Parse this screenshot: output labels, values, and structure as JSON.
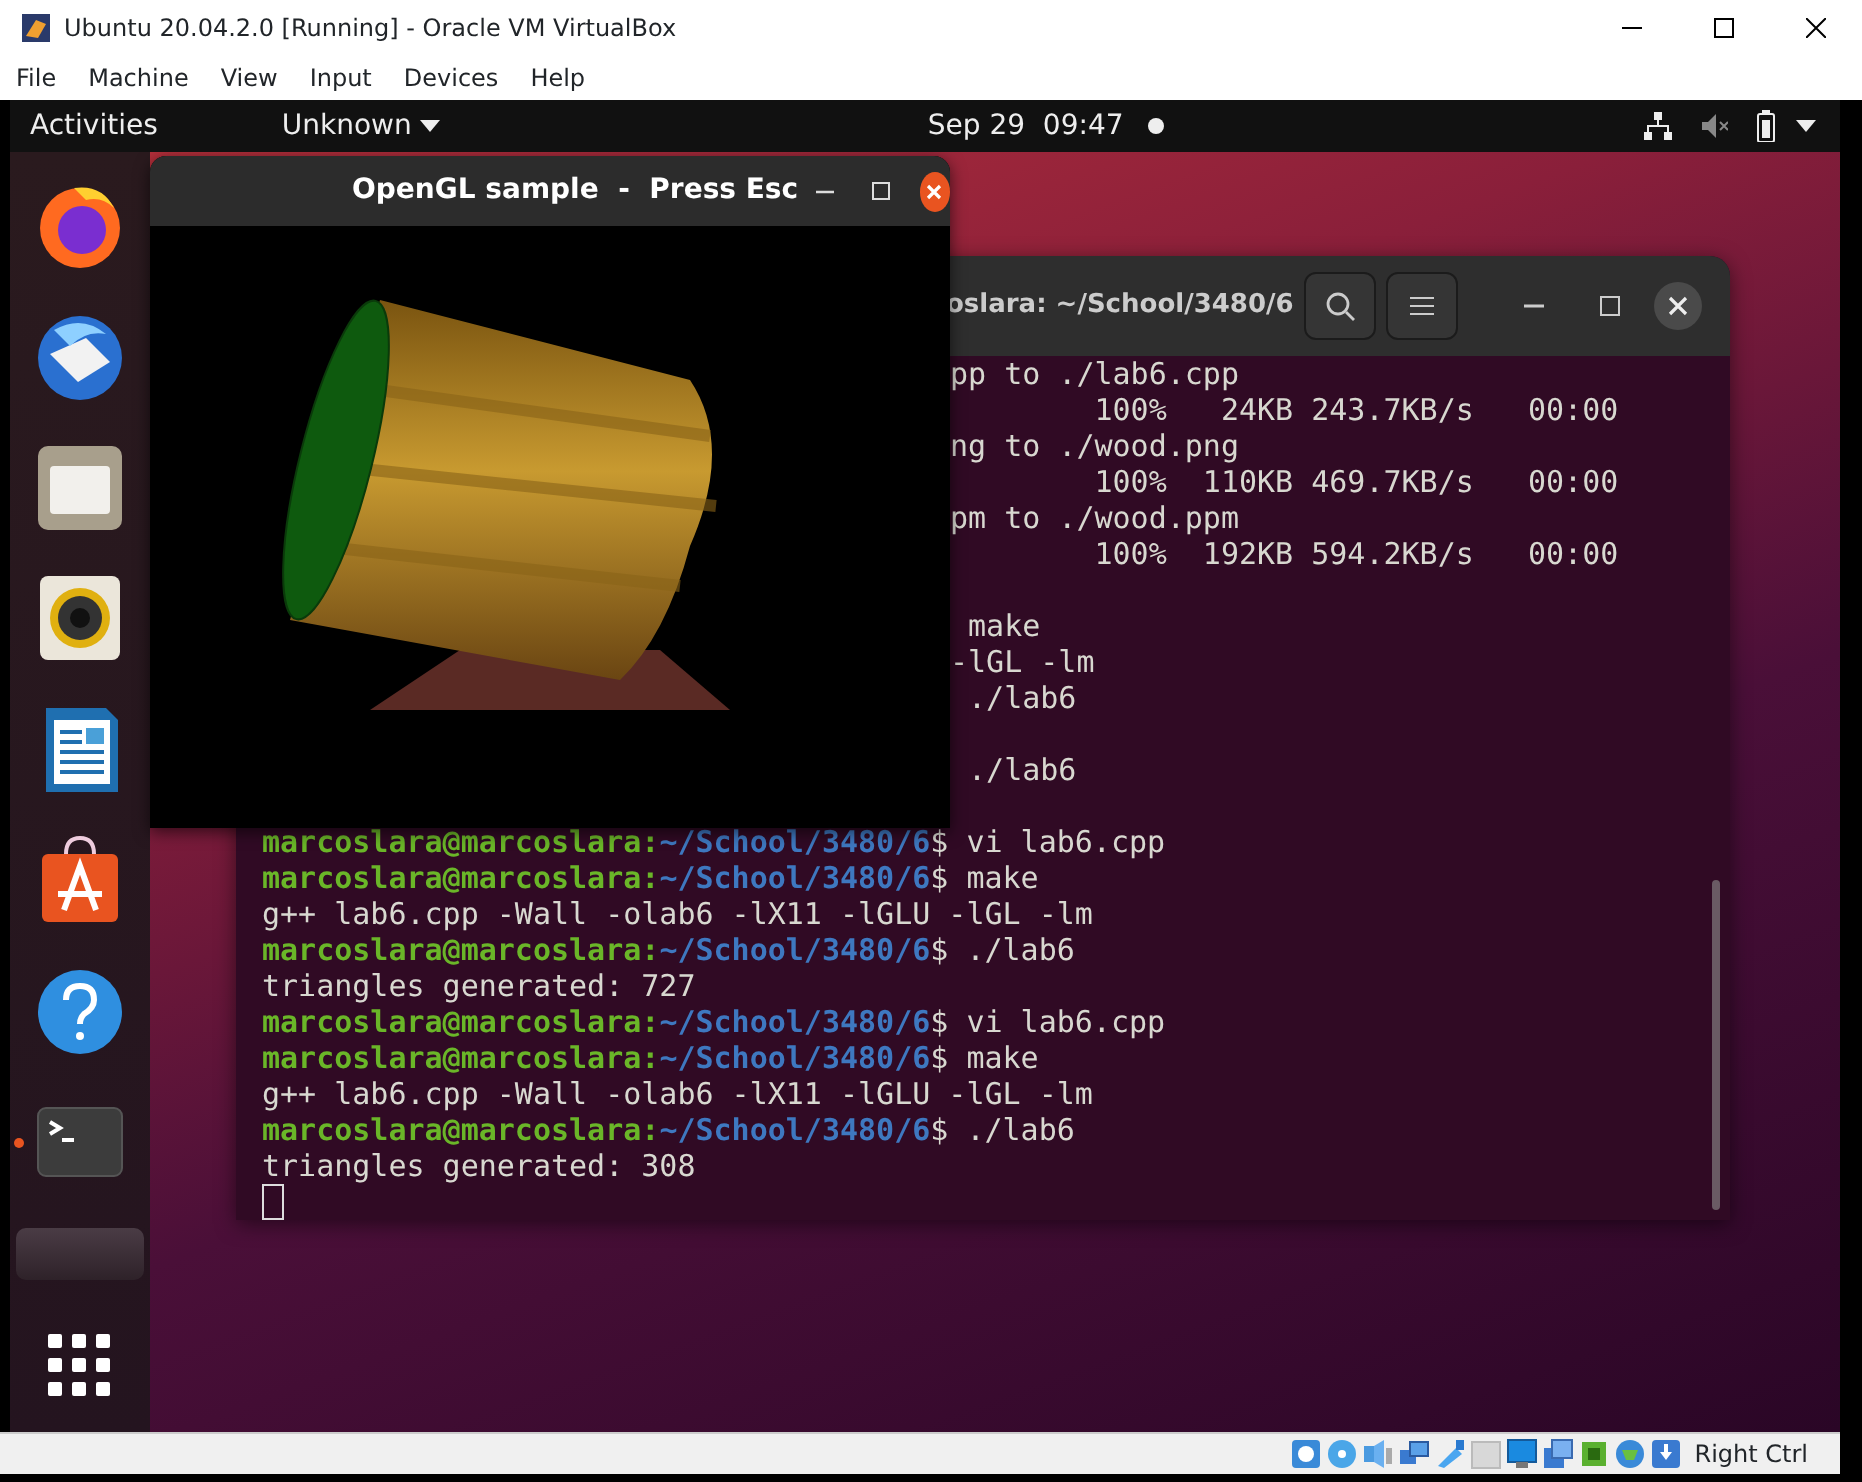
{
  "window": {
    "title": "Ubuntu 20.04.2.0 [Running] - Oracle VM VirtualBox"
  },
  "menu": [
    "File",
    "Machine",
    "View",
    "Input",
    "Devices",
    "Help"
  ],
  "top_bar": {
    "activities": "Activities",
    "app_menu": "Unknown",
    "date": "Sep 29",
    "time": "09:47"
  },
  "dock": [
    {
      "kind": "firefox",
      "running": false
    },
    {
      "kind": "thunderbird",
      "running": false
    },
    {
      "kind": "files",
      "running": false
    },
    {
      "kind": "rhythmbox",
      "running": false
    },
    {
      "kind": "writer",
      "running": false
    },
    {
      "kind": "software",
      "running": false
    },
    {
      "kind": "help",
      "running": false
    },
    {
      "kind": "terminal",
      "running": true
    },
    {
      "kind": "blank",
      "running": false
    },
    {
      "kind": "apps",
      "running": false
    }
  ],
  "gl_window": {
    "title": "OpenGL sample  -  Press Esc"
  },
  "terminal": {
    "title": "oslara: ~/School/3480/6",
    "lines": [
      {
        "kind": "partial",
        "text": "pp to ./lab6.cpp"
      },
      {
        "kind": "partial",
        "text": "        100%   24KB 243.7KB/s   00:00"
      },
      {
        "kind": "partial",
        "text": "ng to ./wood.png"
      },
      {
        "kind": "partial",
        "text": "        100%  110KB 469.7KB/s   00:00"
      },
      {
        "kind": "partial",
        "text": "pm to ./wood.ppm"
      },
      {
        "kind": "partial",
        "text": "        100%  192KB 594.2KB/s   00:00"
      },
      {
        "kind": "blank"
      },
      {
        "kind": "partial",
        "text": " make"
      },
      {
        "kind": "partial",
        "text": "-lGL -lm"
      },
      {
        "kind": "partial",
        "text": " ./lab6"
      },
      {
        "kind": "blank"
      },
      {
        "kind": "partial",
        "text": " ./lab6"
      },
      {
        "kind": "blank"
      },
      {
        "kind": "prompt",
        "user": "marcoslara@marcoslara:",
        "path": "~/School/3480/6",
        "command": "$ vi lab6.cpp"
      },
      {
        "kind": "prompt",
        "user": "marcoslara@marcoslara:",
        "path": "~/School/3480/6",
        "command": "$ make"
      },
      {
        "kind": "output",
        "text": "g++ lab6.cpp -Wall -olab6 -lX11 -lGLU -lGL -lm"
      },
      {
        "kind": "prompt",
        "user": "marcoslara@marcoslara:",
        "path": "~/School/3480/6",
        "command": "$ ./lab6"
      },
      {
        "kind": "output",
        "text": "triangles generated: 727"
      },
      {
        "kind": "prompt",
        "user": "marcoslara@marcoslara:",
        "path": "~/School/3480/6",
        "command": "$ vi lab6.cpp"
      },
      {
        "kind": "prompt",
        "user": "marcoslara@marcoslara:",
        "path": "~/School/3480/6",
        "command": "$ make"
      },
      {
        "kind": "output",
        "text": "g++ lab6.cpp -Wall -olab6 -lX11 -lGLU -lGL -lm"
      },
      {
        "kind": "prompt",
        "user": "marcoslara@marcoslara:",
        "path": "~/School/3480/6",
        "command": "$ ./lab6"
      },
      {
        "kind": "output",
        "text": "triangles generated: 308"
      },
      {
        "kind": "cursor"
      }
    ]
  },
  "status_bar": {
    "host_key": "Right Ctrl"
  }
}
